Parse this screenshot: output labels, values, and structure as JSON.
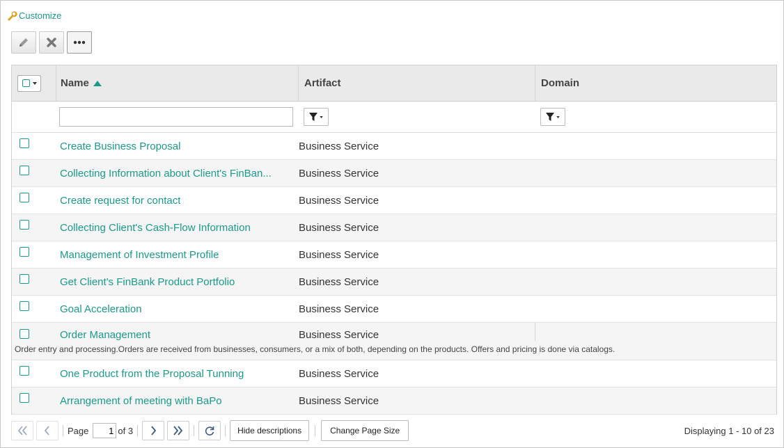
{
  "customize": {
    "label": "Customize",
    "icon": "wrench-icon"
  },
  "toolbar": {
    "edit_icon": "pencil-icon",
    "delete_icon": "x-icon",
    "more_icon": "ellipsis-icon"
  },
  "columns": {
    "name": "Name",
    "artifact": "Artifact",
    "domain": "Domain"
  },
  "filters": {
    "name_value": ""
  },
  "rows": [
    {
      "name": "Create Business Proposal",
      "artifact": "Business Service",
      "domain": ""
    },
    {
      "name": "Collecting Information about Client's FinBan...",
      "artifact": "Business Service",
      "domain": ""
    },
    {
      "name": "Create request for contact",
      "artifact": "Business Service",
      "domain": ""
    },
    {
      "name": "Collecting Client's Cash-Flow Information",
      "artifact": "Business Service",
      "domain": ""
    },
    {
      "name": "Management of Investment Profile",
      "artifact": "Business Service",
      "domain": ""
    },
    {
      "name": "Get Client's FinBank Product Portfolio",
      "artifact": "Business Service",
      "domain": ""
    },
    {
      "name": "Goal Acceleration",
      "artifact": "Business Service",
      "domain": ""
    },
    {
      "name": "Order Management",
      "artifact": "Business Service",
      "domain": "",
      "description": "Order entry and processing.Orders are received from businesses, consumers, or a mix of both, depending on the products. Offers and pricing is done via catalogs."
    },
    {
      "name": "One Product from the Proposal Tunning",
      "artifact": "Business Service",
      "domain": ""
    },
    {
      "name": "Arrangement of meeting with BaPo",
      "artifact": "Business Service",
      "domain": ""
    }
  ],
  "pager": {
    "page_label": "Page",
    "page_value": "1",
    "of_label": "of 3",
    "hide_descriptions": "Hide descriptions",
    "change_page_size": "Change Page Size",
    "display_text": "Displaying 1 - 10 of 23"
  },
  "colors": {
    "accent": "#1a9a8a",
    "header_bg": "#eaeaea",
    "alt_row": "#f5f5f5"
  }
}
